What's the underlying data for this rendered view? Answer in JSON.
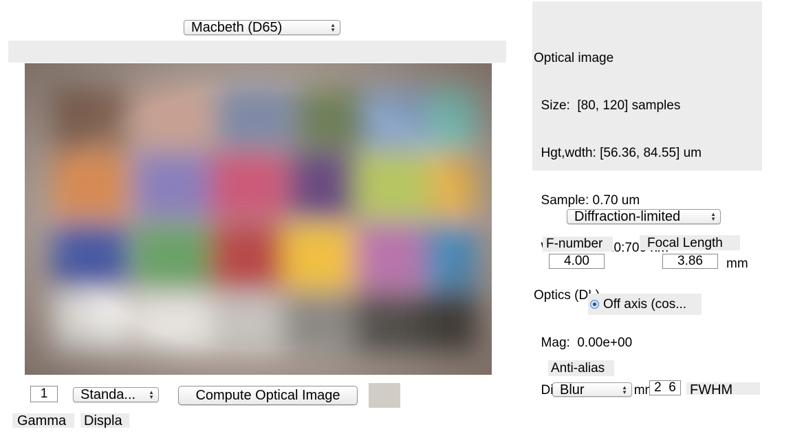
{
  "scene": {
    "selected": "Macbeth (D65)"
  },
  "info_panel": {
    "lines": [
      "Optical image",
      "  Size:  [80, 120] samples",
      "  Hgt,wdth: [56.36, 84.55] um",
      "  Sample: 0.70 um",
      "  Wave: 400:10:700 nm",
      "Optics (DL)",
      "  Mag:  0.00e+00",
      "  Diameter:  0.97 mm"
    ]
  },
  "optics": {
    "model": "Diffraction-limited",
    "fnumber_label": "F-number",
    "fnumber_value": "4.00",
    "focal_label": "Focal Length",
    "focal_value": "3.86",
    "focal_unit": "mm",
    "offaxis_label": "Off axis (cos..."
  },
  "antialias": {
    "label": "Anti-alias",
    "method": "Blur",
    "fwhm_value": "2  6",
    "fwhm_label": "FWHM"
  },
  "bottom": {
    "gamma_value": "1",
    "display_selected": "Standa...",
    "compute_button": "Compute Optical Image",
    "gamma_label": "Gamma",
    "display_label": "Displa"
  },
  "colors": {
    "panel_bg": "#ececec",
    "swatch": "#d2ccc6"
  },
  "icons": {
    "popup_arrows": "updown-arrows-icon",
    "radio": "radio-selected-icon"
  }
}
